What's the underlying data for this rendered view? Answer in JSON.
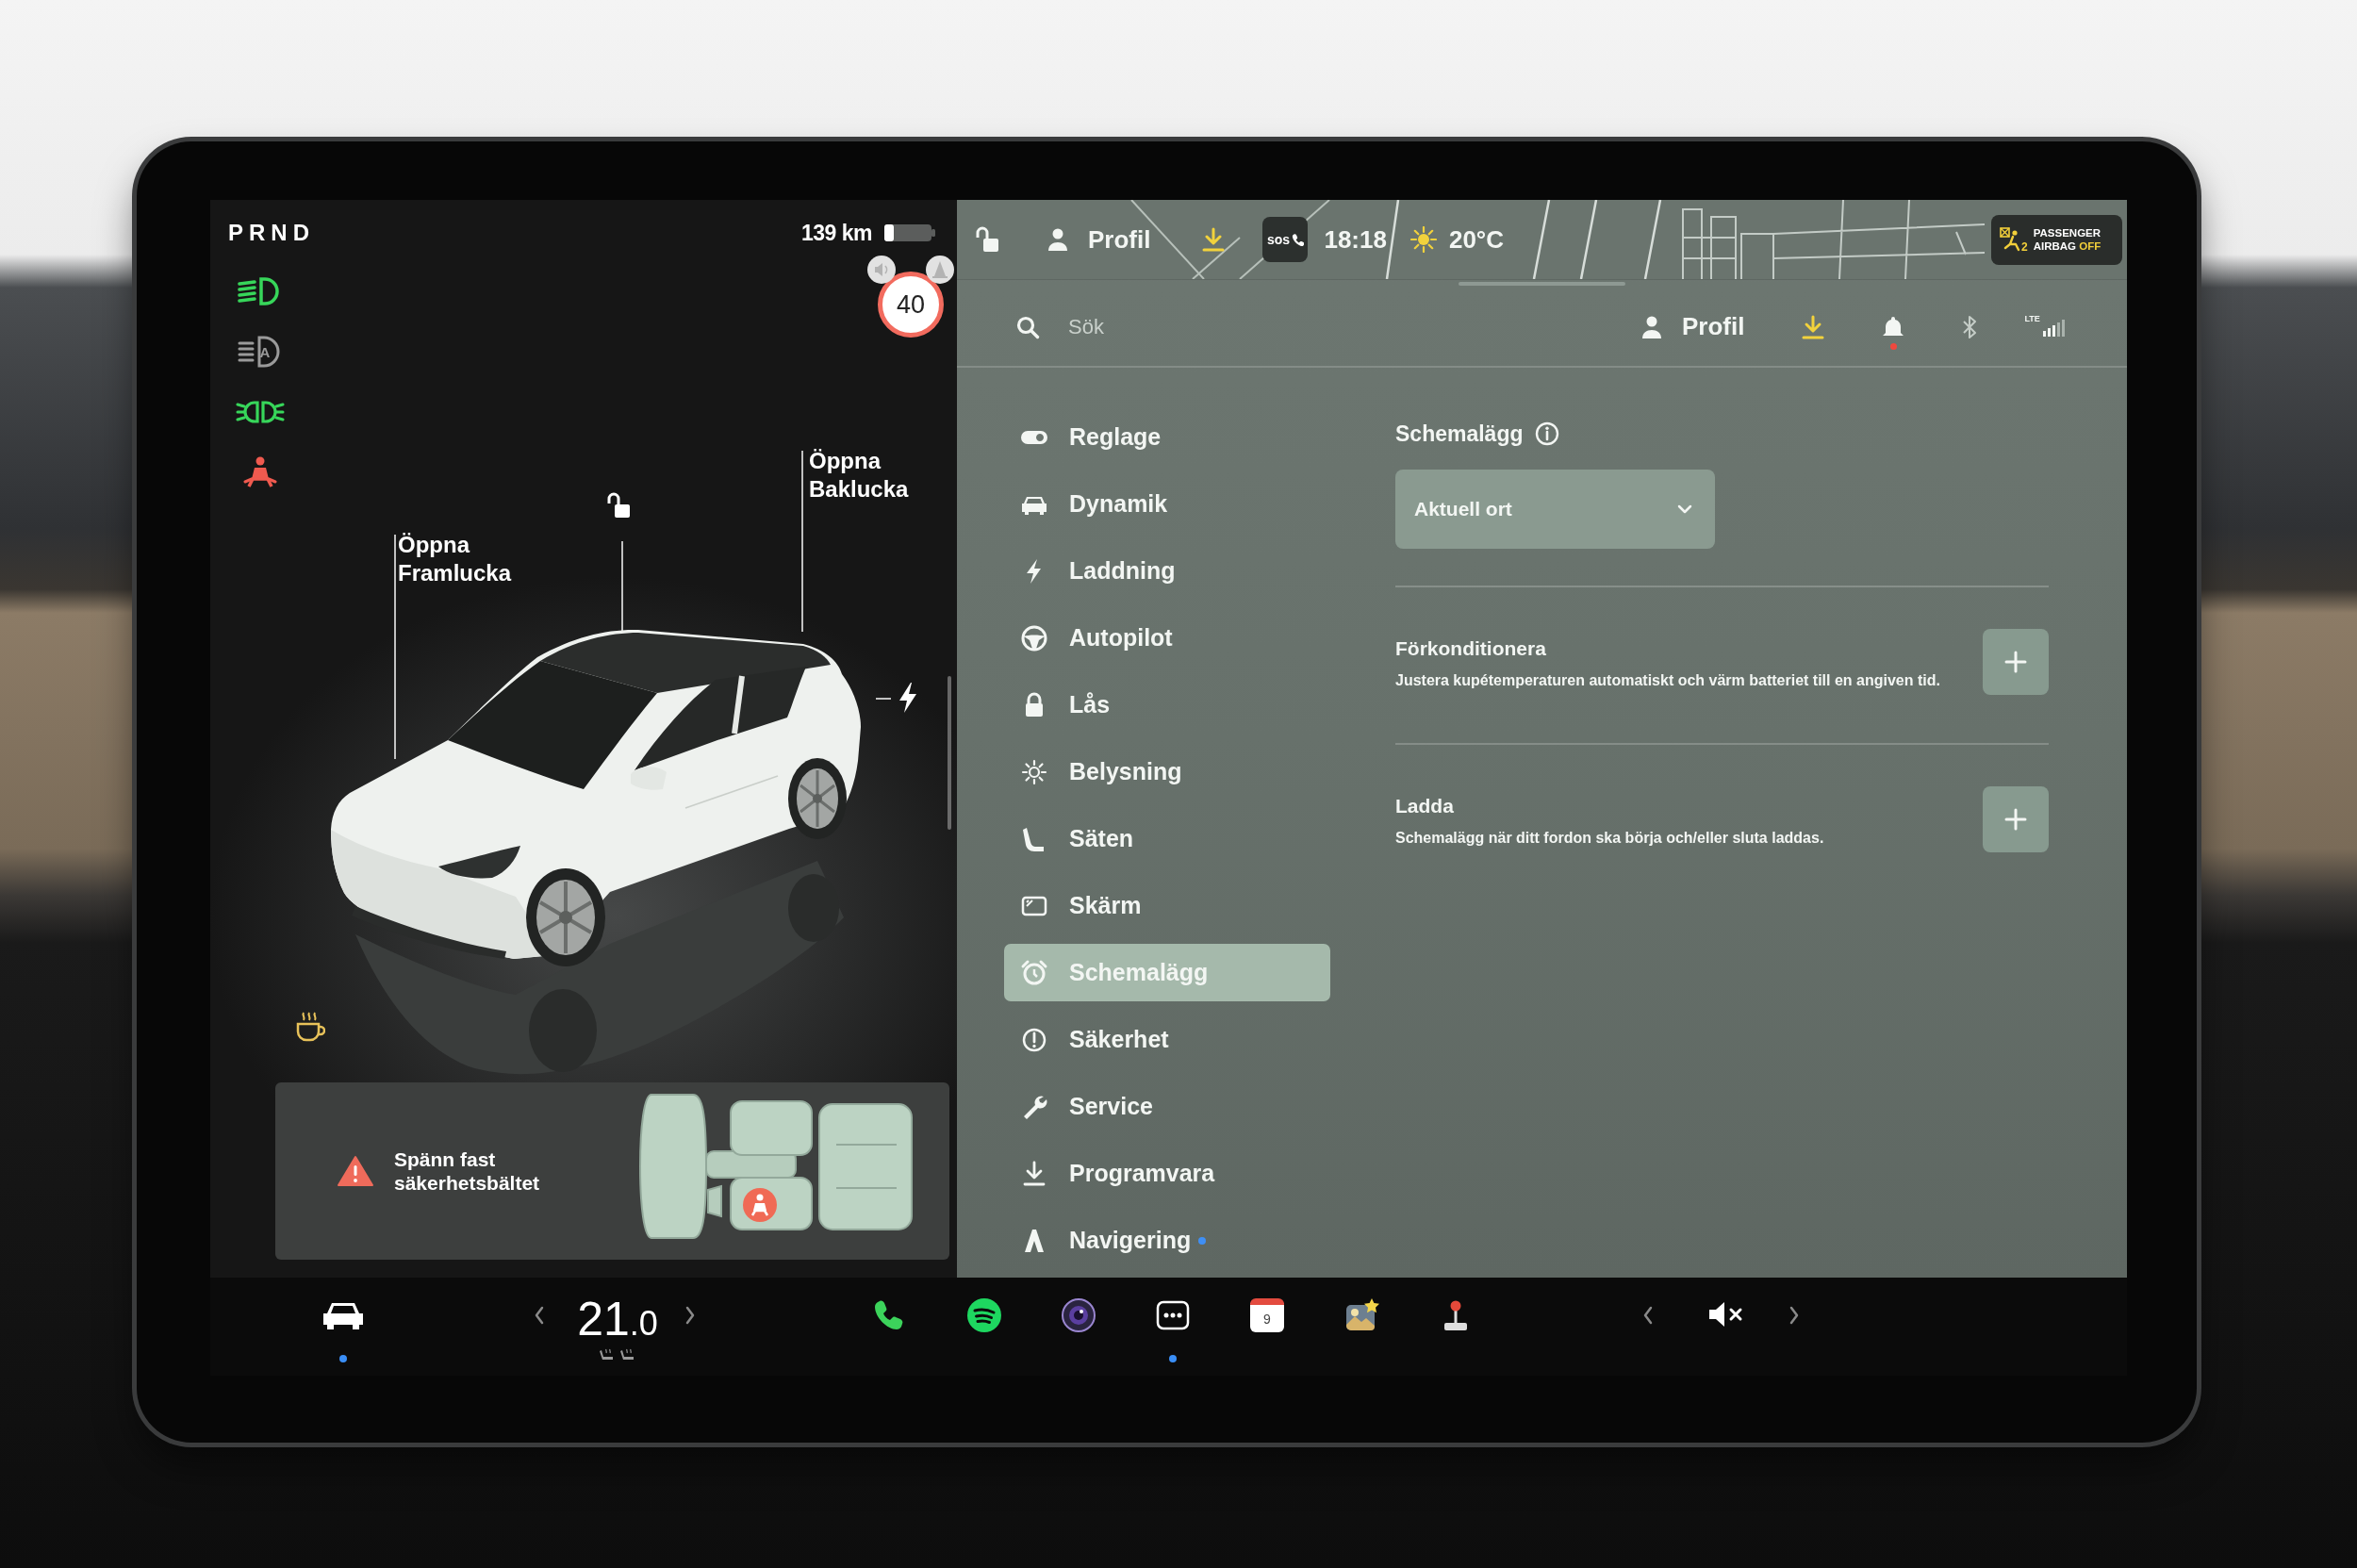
{
  "vehicle": {
    "gear": "PRND",
    "range": "139 km",
    "speed_limit": "40",
    "indicators": [
      {
        "color": "#37d65a"
      },
      {
        "color": "#9a9a9a",
        "label": "A"
      },
      {
        "color": "#37d65a"
      },
      {
        "color": "#f05a4f"
      }
    ],
    "locked": false,
    "doors": [
      {
        "label": "Öppna Framlucka"
      },
      {
        "label": "Öppna Baklucka"
      }
    ],
    "alert": {
      "message": "Spänn fast säkerhetsbältet"
    }
  },
  "top_bar": {
    "locked": false,
    "profile": "Profil",
    "sos": "sos",
    "time": "18:18",
    "temperature": "20°C",
    "airbag": {
      "seat": "2",
      "label": "PASSENGER AIRBAG",
      "status": "OFF"
    }
  },
  "search": {
    "placeholder": "Sök"
  },
  "account": {
    "profile": "Profil",
    "notifications": true,
    "network": "LTE"
  },
  "menu": [
    {
      "label": "Reglage",
      "selected": false,
      "dot": false
    },
    {
      "label": "Dynamik",
      "selected": false,
      "dot": false
    },
    {
      "label": "Laddning",
      "selected": false,
      "dot": false
    },
    {
      "label": "Autopilot",
      "selected": false,
      "dot": false
    },
    {
      "label": "Lås",
      "selected": false,
      "dot": false
    },
    {
      "label": "Belysning",
      "selected": false,
      "dot": false
    },
    {
      "label": "Säten",
      "selected": false,
      "dot": false
    },
    {
      "label": "Skärm",
      "selected": false,
      "dot": false
    },
    {
      "label": "Schemalägg",
      "selected": true,
      "dot": false
    },
    {
      "label": "Säkerhet",
      "selected": false,
      "dot": false
    },
    {
      "label": "Service",
      "selected": false,
      "dot": false
    },
    {
      "label": "Programvara",
      "selected": false,
      "dot": false
    },
    {
      "label": "Navigering",
      "selected": false,
      "dot": true
    }
  ],
  "schedule": {
    "title": "Schemalägg",
    "location": "Aktuell ort",
    "sections": [
      {
        "title": "Förkonditionera",
        "description": "Justera kupétemperaturen automatiskt och värm batteriet till en angiven tid."
      },
      {
        "title": "Ladda",
        "description": "Schemalägg när ditt fordon ska börja och/eller sluta laddas."
      }
    ]
  },
  "dock": {
    "car": {
      "active": true
    },
    "temperature": {
      "whole": "21",
      "fraction": ".0"
    },
    "apps": [
      {
        "active": false
      },
      {
        "active": false
      },
      {
        "active": false
      },
      {
        "active": true
      },
      {
        "active": false,
        "day": "9"
      },
      {
        "active": false
      },
      {
        "active": false
      }
    ],
    "volume": {
      "muted": true
    }
  }
}
